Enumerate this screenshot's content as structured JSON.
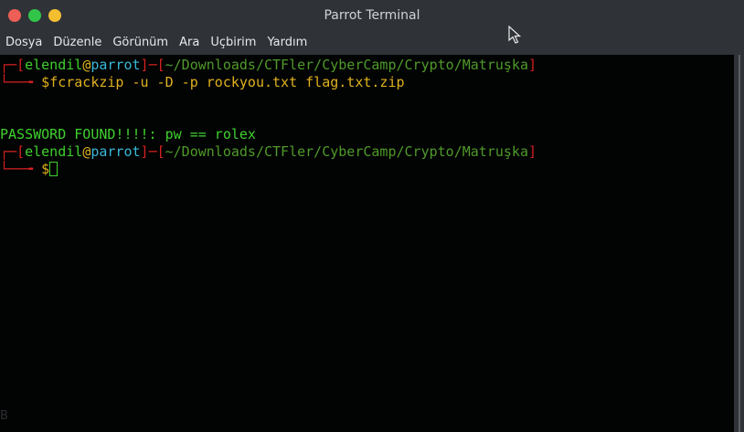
{
  "window": {
    "title": "Parrot Terminal",
    "colors": {
      "close": "#ed5f56",
      "maximize": "#31c549",
      "minimize": "#f3be2f"
    }
  },
  "menu": {
    "items": [
      "Dosya",
      "Düzenle",
      "Görünüm",
      "Ara",
      "Uçbirim",
      "Yardım"
    ]
  },
  "terminal": {
    "prompt1": {
      "corner": "┌─",
      "open": "[",
      "user": "elendil",
      "at": "@",
      "host": "parrot",
      "close": "]",
      "dash": "─",
      "path_open": "[",
      "path": "~/Downloads/CTFler/CyberCamp/Crypto/Matruşka",
      "path_close": "]",
      "corner2": "└──╼ ",
      "dollar": "$",
      "command": "fcrackzip -u -D -p rockyou.txt flag.txt.zip"
    },
    "output": "PASSWORD FOUND!!!!: pw == rolex",
    "prompt2": {
      "corner": "┌─",
      "open": "[",
      "user": "elendil",
      "at": "@",
      "host": "parrot",
      "close": "]",
      "dash": "─",
      "path_open": "[",
      "path": "~/Downloads/CTFler/CyberCamp/Crypto/Matruşka",
      "path_close": "]",
      "corner2": "└──╼ ",
      "dollar": "$"
    }
  },
  "status_glyph": "B"
}
